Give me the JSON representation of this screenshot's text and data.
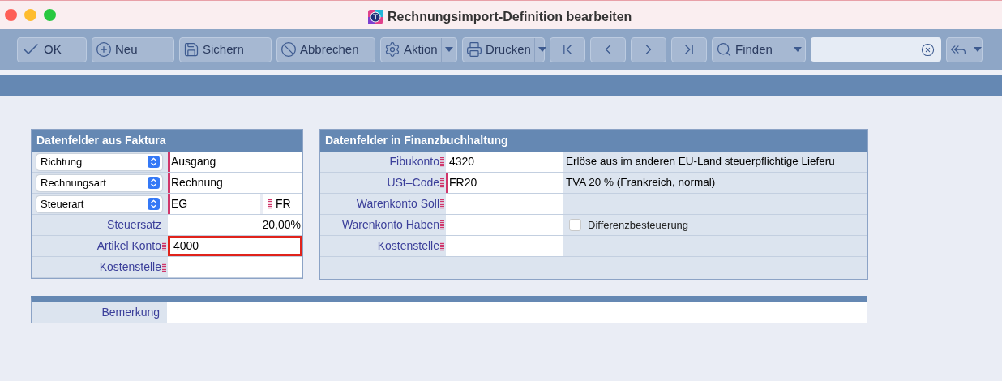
{
  "window": {
    "title": "Rechnungsimport-Definition bearbeiten"
  },
  "toolbar": [
    {
      "kind": "button",
      "label": "OK"
    },
    {
      "kind": "button",
      "label": "Neu"
    },
    {
      "kind": "button",
      "label": "Sichern"
    },
    {
      "kind": "button",
      "label": "Abbrechen"
    },
    {
      "kind": "dropdown",
      "label": "Aktion"
    },
    {
      "kind": "dropdown",
      "label": "Drucken"
    },
    {
      "kind": "nav"
    },
    {
      "kind": "nav"
    },
    {
      "kind": "nav"
    },
    {
      "kind": "nav"
    },
    {
      "kind": "dropdown",
      "label": "Finden"
    },
    {
      "kind": "search"
    },
    {
      "kind": "dropdown"
    }
  ],
  "left_panel": {
    "title": "Datenfelder aus Faktura",
    "rows": [
      {
        "kind": "select",
        "label": "Richtung",
        "value": "Ausgang",
        "required": true,
        "lookup": false,
        "focused": false
      },
      {
        "kind": "select",
        "label": "Rechnungsart",
        "value": "Rechnung",
        "required": true,
        "lookup": false,
        "focused": false
      },
      {
        "kind": "select",
        "label": "Steuerart",
        "value": "EG",
        "required": true,
        "lookup": false,
        "focused": false,
        "extra": "FR"
      },
      {
        "kind": "readonly",
        "label": "Steuersatz",
        "value": "20,00%",
        "required": false,
        "lookup": false,
        "focused": false
      },
      {
        "kind": "field",
        "label": "Artikel Konto",
        "value": "4000",
        "required": false,
        "lookup": true,
        "focused": true
      },
      {
        "kind": "field",
        "label": "Kostenstelle",
        "required": false,
        "lookup": true,
        "focused": false
      }
    ]
  },
  "right_panel": {
    "title": "Datenfelder in Finanzbuchhaltung",
    "rows": [
      {
        "label": "Fibukonto",
        "value": "4320",
        "required": false,
        "lookup": true,
        "description": "Erlöse aus im anderen EU-Land steuerpflichtige Lieferu"
      },
      {
        "label": "USt–Code",
        "value": "FR20",
        "required": true,
        "lookup": true,
        "description": "TVA 20 % (Frankreich, normal)"
      },
      {
        "label": "Warenkonto Soll",
        "required": false,
        "lookup": true
      },
      {
        "label": "Warenkonto Haben",
        "required": false,
        "lookup": true,
        "checkbox": {
          "label": "Differenzbesteuerung",
          "checked": false
        }
      },
      {
        "label": "Kostenstelle",
        "required": false,
        "lookup": true
      }
    ]
  },
  "remarks": {
    "label": "Bemerkung"
  }
}
